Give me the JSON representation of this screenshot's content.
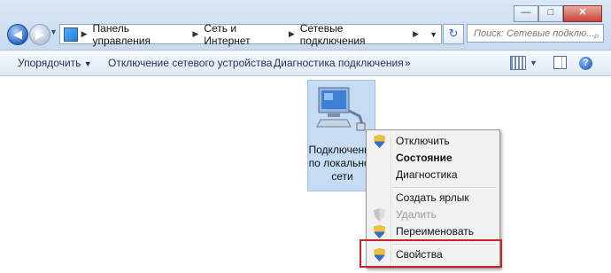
{
  "window": {
    "minimize": "—",
    "maximize": "□",
    "close": "✕"
  },
  "nav": {
    "back_icon": "arrow-left-icon",
    "forward_icon": "arrow-right-icon"
  },
  "breadcrumbs": [
    "Панель управления",
    "Сеть и Интернет",
    "Сетевые подключения"
  ],
  "search": {
    "placeholder": "Поиск: Сетевые подклю..."
  },
  "toolbar": {
    "organize": "Упорядочить",
    "disable": "Отключение сетевого устройства",
    "diagnose": "Диагностика подключения",
    "more": "»"
  },
  "item": {
    "label": "Подключение по локальной сети"
  },
  "context_menu": {
    "items": [
      {
        "label": "Отключить",
        "shield": true,
        "bold": false,
        "disabled": false
      },
      {
        "label": "Состояние",
        "shield": false,
        "bold": true,
        "disabled": false
      },
      {
        "label": "Диагностика",
        "shield": false,
        "bold": false,
        "disabled": false
      },
      {
        "label": "Создать ярлык",
        "shield": false,
        "bold": false,
        "disabled": false
      },
      {
        "label": "Удалить",
        "shield": true,
        "bold": false,
        "disabled": true
      },
      {
        "label": "Переименовать",
        "shield": true,
        "bold": false,
        "disabled": false
      },
      {
        "label": "Свойства",
        "shield": true,
        "bold": false,
        "disabled": false
      }
    ]
  },
  "colors": {
    "highlight": "#c9242b",
    "selection": "#c6dcf5"
  }
}
